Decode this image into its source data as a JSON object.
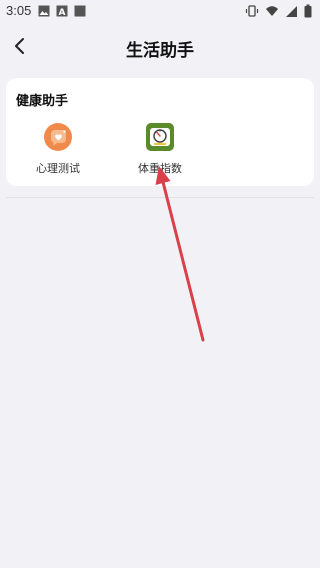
{
  "status_bar": {
    "time": "3:05",
    "icons_left": [
      "image-icon",
      "text-a-icon",
      "square-icon"
    ],
    "icons_right": [
      "vibrate-icon",
      "wifi-icon",
      "signal-icon",
      "battery-icon"
    ]
  },
  "header": {
    "title": "生活助手",
    "back_icon": "chevron-left-icon"
  },
  "health_card": {
    "title": "健康助手",
    "items": [
      {
        "label": "心理测试",
        "icon": "chat-heart-icon",
        "color": "#f08a4b"
      },
      {
        "label": "体重指数",
        "icon": "scale-icon",
        "color": "#5a8a2a"
      }
    ]
  },
  "colors": {
    "background": "#f2f2f6",
    "card": "#ffffff",
    "annotation_arrow": "#d9414a"
  }
}
